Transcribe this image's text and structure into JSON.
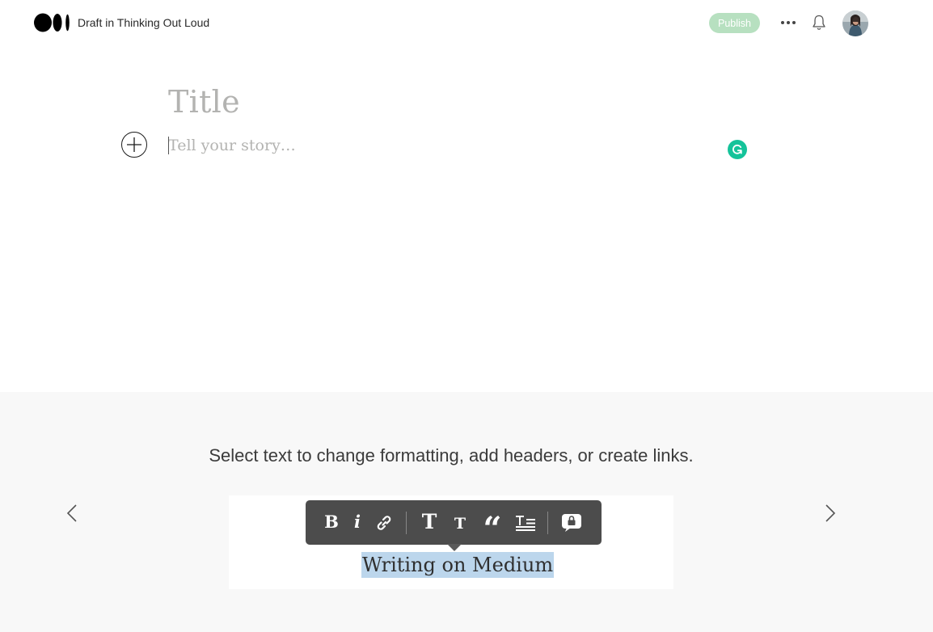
{
  "header": {
    "draft_label": "Draft in Thinking Out Loud",
    "publish_label": "Publish",
    "logo_icon": "medium-logo-icon",
    "more_icon": "more-icon",
    "notifications_icon": "bell-icon",
    "avatar": "avatar"
  },
  "editor": {
    "title_placeholder": "Title",
    "story_placeholder": "Tell your story…",
    "add_icon": "plus-circle-icon",
    "grammarly_icon": "grammarly-icon"
  },
  "tips": {
    "text": "Select text to change formatting, add headers, or create links.",
    "prev_icon": "chevron-left-icon",
    "next_icon": "chevron-right-icon",
    "preview": {
      "toolbar_icons": [
        "bold-icon",
        "italic-icon",
        "link-icon",
        "large-heading-icon",
        "small-heading-icon",
        "quote-icon",
        "drop-cap-icon",
        "private-note-icon"
      ],
      "bold_label": "B",
      "italic_label": "i",
      "heading_large_label": "T",
      "heading_small_label": "T",
      "quote_label": "“",
      "sample_text": "Writing on Medium"
    }
  },
  "colors": {
    "publish_bg": "#b7e0c0",
    "grammarly": "#15c39a",
    "tips_bg": "#f8f8f8",
    "selection": "#bcd6ec"
  }
}
